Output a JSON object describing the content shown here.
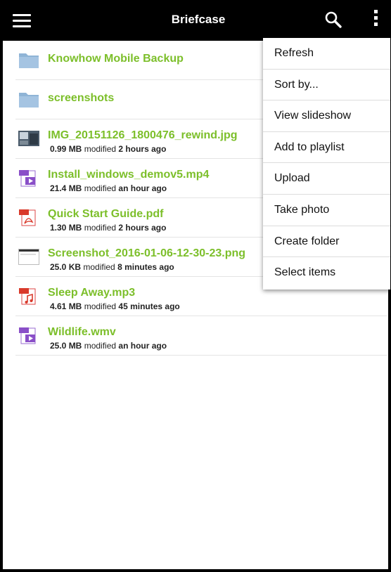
{
  "appbar": {
    "title": "Briefcase",
    "menu_icon": "hamburger-menu-icon",
    "search_icon": "search-icon",
    "overflow_icon": "overflow-menu-icon"
  },
  "files": [
    {
      "type": "folder",
      "icon": "folder-icon",
      "name": "Knowhow Mobile Backup"
    },
    {
      "type": "folder",
      "icon": "folder-icon",
      "name": "screenshots"
    },
    {
      "type": "file",
      "icon": "image-thumbnail-icon",
      "name": "IMG_20151126_1800476_rewind.jpg",
      "size": "0.99 MB",
      "modified_label": "modified",
      "time": "2 hours ago"
    },
    {
      "type": "file",
      "icon": "mp4-file-icon",
      "name": "Install_windows_demov5.mp4",
      "size": "21.4 MB",
      "modified_label": "modified",
      "time": "an hour ago"
    },
    {
      "type": "file",
      "icon": "pdf-file-icon",
      "name": "Quick Start Guide.pdf",
      "size": "1.30 MB",
      "modified_label": "modified",
      "time": "2 hours ago"
    },
    {
      "type": "file",
      "icon": "screenshot-thumbnail-icon",
      "name": "Screenshot_2016-01-06-12-30-23.png",
      "size": "25.0 KB",
      "modified_label": "modified",
      "time": "8 minutes ago"
    },
    {
      "type": "file",
      "icon": "mp3-file-icon",
      "name": "Sleep Away.mp3",
      "size": "4.61 MB",
      "modified_label": "modified",
      "time": "45 minutes ago"
    },
    {
      "type": "file",
      "icon": "wmv-file-icon",
      "name": "Wildlife.wmv",
      "size": "25.0 MB",
      "modified_label": "modified",
      "time": "an hour ago"
    }
  ],
  "popup_menu": {
    "items": [
      "Refresh",
      "Sort by...",
      "View slideshow",
      "Add to playlist",
      "Upload",
      "Take photo",
      "Create folder",
      "Select items"
    ]
  },
  "colors": {
    "accent_green": "#7cbf2a",
    "appbar_bg": "#000000",
    "folder_blue": "#8fb4d6"
  }
}
